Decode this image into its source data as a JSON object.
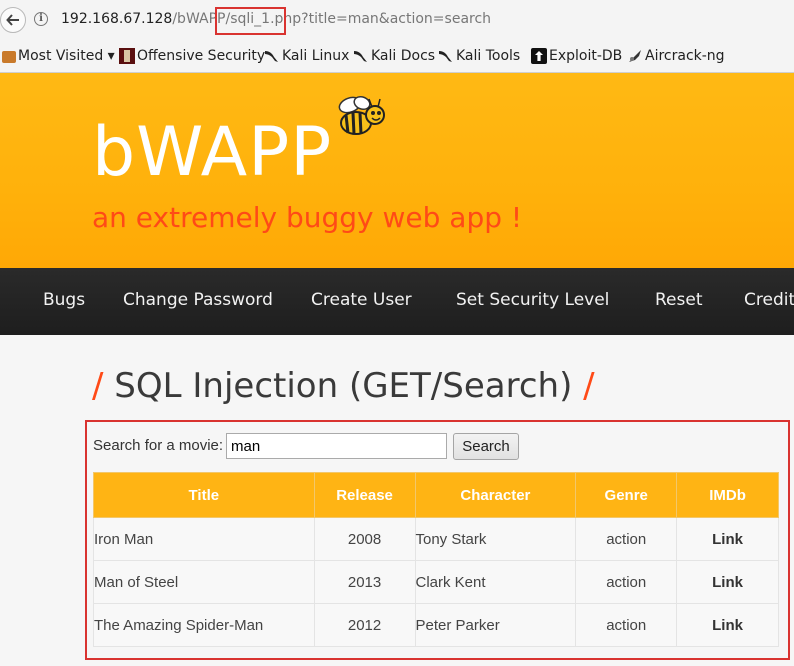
{
  "browser": {
    "url_host": "192.168.67.128",
    "url_rest": "/bWAPP/sqli_1.php?title=man&action=search",
    "bookmarks": [
      {
        "label": "Most Visited ▾",
        "icon": "folder-icon"
      },
      {
        "label": "Offensive Security",
        "icon": "offensive-security-icon"
      },
      {
        "label": "Kali Linux",
        "icon": "kali-dragon-icon"
      },
      {
        "label": "Kali Docs",
        "icon": "kali-dragon-icon"
      },
      {
        "label": "Kali Tools",
        "icon": "kali-dragon-icon"
      },
      {
        "label": "Exploit-DB",
        "icon": "exploit-db-icon"
      },
      {
        "label": "Aircrack-ng",
        "icon": "aircrack-icon"
      }
    ]
  },
  "site": {
    "logo": "bWAPP",
    "tagline": "an extremely buggy web app !",
    "colors": {
      "header": "#ffb10b",
      "accent": "#ff4a17",
      "nav": "#222222",
      "table_header": "#ffb414"
    }
  },
  "nav": {
    "items": [
      "Bugs",
      "Change Password",
      "Create User",
      "Set Security Level",
      "Reset",
      "Credits"
    ]
  },
  "main": {
    "title_slash": "/",
    "title": "SQL Injection (GET/Search)",
    "search_label": "Search for a movie:",
    "search_value": "man",
    "search_button": "Search",
    "table": {
      "headers": [
        "Title",
        "Release",
        "Character",
        "Genre",
        "IMDb"
      ],
      "rows": [
        {
          "title": "Iron Man",
          "release": "2008",
          "character": "Tony Stark",
          "genre": "action",
          "imdb": "Link"
        },
        {
          "title": "Man of Steel",
          "release": "2013",
          "character": "Clark Kent",
          "genre": "action",
          "imdb": "Link"
        },
        {
          "title": "The Amazing Spider-Man",
          "release": "2012",
          "character": "Peter Parker",
          "genre": "action",
          "imdb": "Link"
        }
      ]
    }
  }
}
